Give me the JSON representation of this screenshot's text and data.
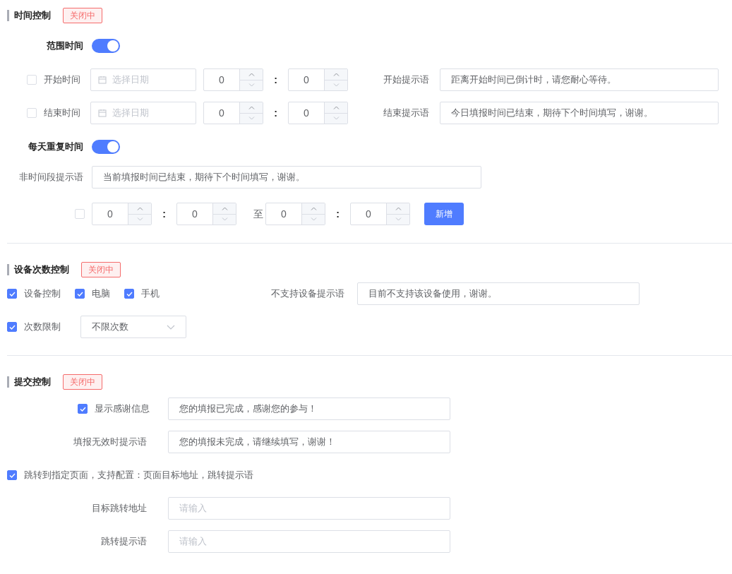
{
  "time_control": {
    "title": "时间控制",
    "status": "关闭中",
    "range_time": {
      "label": "范围时间",
      "on": true
    },
    "range_rows": [
      {
        "label": "开始时间",
        "checked": false,
        "date_placeholder": "选择日期",
        "hour": "0",
        "colon": ":",
        "minute": "0",
        "tip_label": "开始提示语",
        "tip_value": "距离开始时间已倒计时，请您耐心等待。"
      },
      {
        "label": "结束时间",
        "checked": false,
        "date_placeholder": "选择日期",
        "hour": "0",
        "colon": ":",
        "minute": "0",
        "tip_label": "结束提示语",
        "tip_value": "今日填报时间已结束，期待下个时间填写，谢谢。"
      }
    ],
    "daily_repeat": {
      "label": "每天重复时间",
      "on": true
    },
    "off_period_tip": {
      "label": "非时间段提示语",
      "value": "当前填报时间已结束，期待下个时间填写，谢谢。"
    },
    "period_row": {
      "checked": false,
      "start_hour": "0",
      "start_colon": ":",
      "start_minute": "0",
      "to": "至",
      "end_hour": "0",
      "end_colon": ":",
      "end_minute": "0"
    },
    "add_button": "新增"
  },
  "device_control": {
    "title": "设备次数控制",
    "status": "关闭中",
    "devices": [
      {
        "label": "设备控制",
        "checked": true
      },
      {
        "label": "电脑",
        "checked": true
      },
      {
        "label": "手机",
        "checked": true
      }
    ],
    "unsupported_tip": {
      "label": "不支持设备提示语",
      "value": "目前不支持该设备使用，谢谢。"
    },
    "count_limit": {
      "label": "次数限制",
      "checked": true,
      "value": "不限次数"
    }
  },
  "submit_control": {
    "title": "提交控制",
    "status": "关闭中",
    "thanks": {
      "label": "显示感谢信息",
      "checked": true,
      "value": "您的填报已完成，感谢您的参与！"
    },
    "invalid_tip": {
      "label": "填报无效时提示语",
      "value": "您的填报未完成，请继续填写，谢谢！"
    },
    "redirect": {
      "label": "跳转到指定页面，支持配置：页面目标地址，跳转提示语",
      "checked": true
    },
    "target_url": {
      "label": "目标跳转地址",
      "placeholder": "请输入"
    },
    "redirect_tip": {
      "label": "跳转提示语",
      "placeholder": "请输入"
    }
  }
}
